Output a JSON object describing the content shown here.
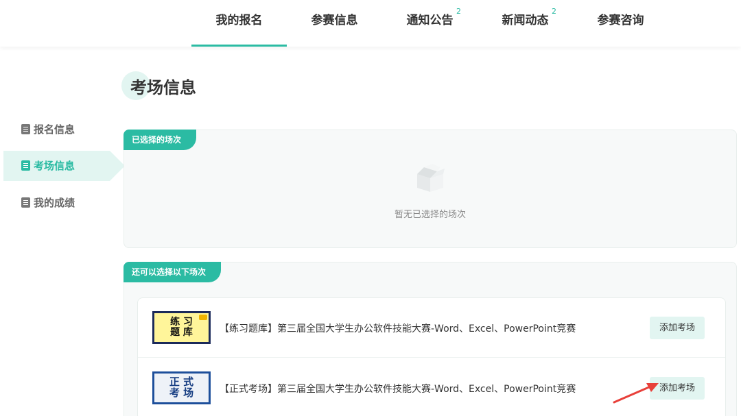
{
  "nav": {
    "tabs": [
      {
        "label": "我的报名",
        "sup": ""
      },
      {
        "label": "参赛信息",
        "sup": ""
      },
      {
        "label": "通知公告",
        "sup": "2"
      },
      {
        "label": "新闻动态",
        "sup": "2"
      },
      {
        "label": "参赛咨询",
        "sup": ""
      }
    ],
    "active_tab": "我的报名"
  },
  "sidebar": {
    "items": [
      {
        "label": "报名信息",
        "icon": "edit-doc-icon"
      },
      {
        "label": "考场信息",
        "icon": "doc-icon"
      },
      {
        "label": "我的成绩",
        "icon": "trash-doc-icon"
      }
    ],
    "active_item": "考场信息"
  },
  "page": {
    "title": "考场信息"
  },
  "selected_panel": {
    "tag": "已选择的场次",
    "empty_text": "暂无已选择的场次"
  },
  "available_panel": {
    "tag": "还可以选择以下场次",
    "sessions": [
      {
        "thumb_line1": "练 习",
        "thumb_line2": "题 库",
        "title": "【练习题库】第三届全国大学生办公软件技能大赛-Word、Excel、PowerPoint竞赛",
        "button": "添加考场"
      },
      {
        "thumb_line1": "正 式",
        "thumb_line2": "考 场",
        "title": "【正式考场】第三届全国大学生办公软件技能大赛-Word、Excel、PowerPoint竞赛",
        "button": "添加考场"
      }
    ]
  },
  "colors": {
    "accent": "#2bbba3",
    "accent_light": "#e2f5f1",
    "annotation_arrow": "#e8403a"
  }
}
